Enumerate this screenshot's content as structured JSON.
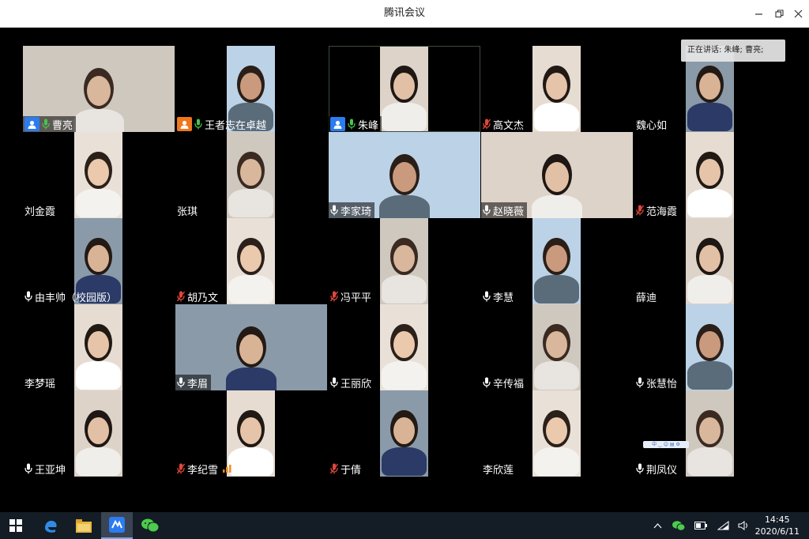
{
  "window": {
    "title": "腾讯会议",
    "minimize_icon": "minimize-icon",
    "restore_icon": "restore-icon",
    "close_icon": "close-icon"
  },
  "speaking": {
    "text": "正在讲话: 朱峰; 曹亮;"
  },
  "participants": [
    {
      "name": "曹亮",
      "role": "host",
      "mic": "on",
      "view": "full"
    },
    {
      "name": "王者志在卓越",
      "role": "cohost",
      "mic": "on",
      "view": "portrait"
    },
    {
      "name": "朱峰",
      "role": "host",
      "mic": "on",
      "view": "portrait-boxed"
    },
    {
      "name": "高文杰",
      "role": "",
      "mic": "muted",
      "view": "portrait"
    },
    {
      "name": "魏心如",
      "role": "",
      "mic": "none",
      "view": "portrait"
    },
    {
      "name": "刘金霞",
      "role": "",
      "mic": "none",
      "view": "portrait"
    },
    {
      "name": "张琪",
      "role": "",
      "mic": "none",
      "view": "portrait"
    },
    {
      "name": "李家琦",
      "role": "",
      "mic": "on",
      "view": "wide"
    },
    {
      "name": "赵晓薇",
      "role": "",
      "mic": "on",
      "view": "wide"
    },
    {
      "name": "范海霞",
      "role": "",
      "mic": "muted",
      "view": "portrait"
    },
    {
      "name": "由丰帅（校园版）",
      "role": "",
      "mic": "on",
      "view": "portrait"
    },
    {
      "name": "胡乃文",
      "role": "",
      "mic": "muted",
      "view": "portrait"
    },
    {
      "name": "冯平平",
      "role": "",
      "mic": "muted",
      "view": "portrait"
    },
    {
      "name": "李慧",
      "role": "",
      "mic": "on",
      "view": "portrait"
    },
    {
      "name": "薛迪",
      "role": "",
      "mic": "none",
      "view": "portrait"
    },
    {
      "name": "李梦瑶",
      "role": "",
      "mic": "none",
      "view": "portrait"
    },
    {
      "name": "李眉",
      "role": "",
      "mic": "on",
      "view": "wide"
    },
    {
      "name": "王丽欣",
      "role": "",
      "mic": "on",
      "view": "portrait"
    },
    {
      "name": "辛传福",
      "role": "",
      "mic": "on",
      "view": "portrait"
    },
    {
      "name": "张慧怡",
      "role": "",
      "mic": "on",
      "view": "portrait"
    },
    {
      "name": "王亚坤",
      "role": "",
      "mic": "on",
      "view": "portrait"
    },
    {
      "name": "李纪雪",
      "role": "",
      "mic": "muted",
      "view": "portrait",
      "signal": true
    },
    {
      "name": "于倩",
      "role": "",
      "mic": "muted",
      "view": "portrait"
    },
    {
      "name": "李欣莲",
      "role": "",
      "mic": "none",
      "view": "portrait"
    },
    {
      "name": "荆凤仪",
      "role": "",
      "mic": "on",
      "view": "portrait"
    }
  ],
  "taskbar": {
    "apps": [
      "windows-start-icon",
      "edge-icon",
      "file-explorer-icon",
      "tencent-meeting-icon",
      "wechat-icon"
    ],
    "tray": [
      "chevron-up-icon",
      "wechat-tray-icon",
      "battery-icon",
      "wifi-icon",
      "volume-icon"
    ],
    "time": "14:45",
    "date": "2020/6/11"
  },
  "colors": {
    "host_badge": "#2b7cf0",
    "cohost_badge": "#f0771b",
    "mic_on": "#ffffff",
    "mic_active": "#49c44b",
    "mic_muted": "#e0473a",
    "taskbar": "#141c26"
  }
}
